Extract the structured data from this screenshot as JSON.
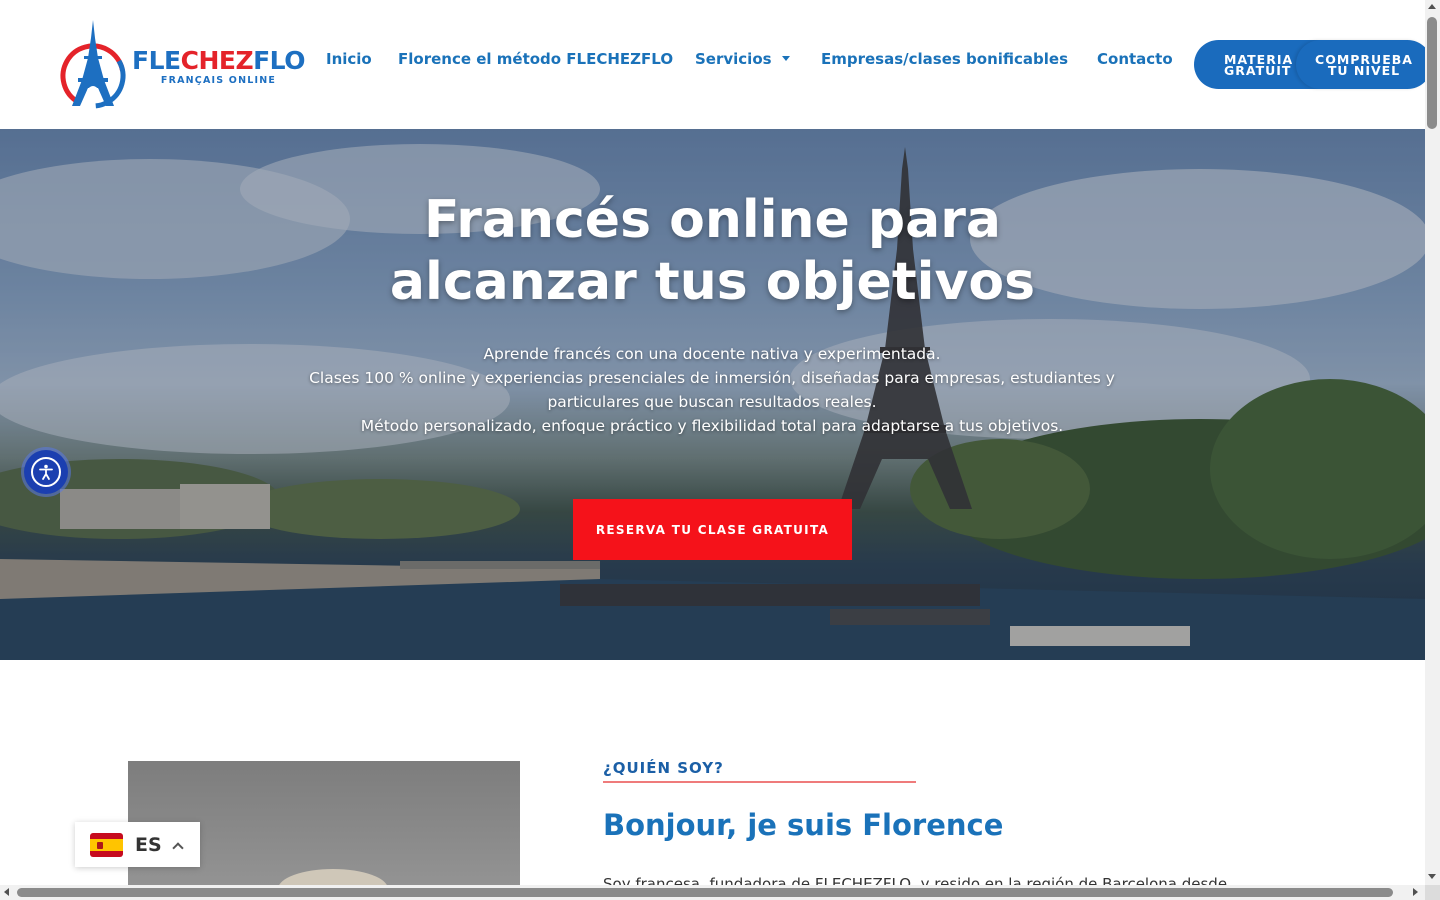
{
  "logo": {
    "part1": "FLE",
    "part2": "CHEZ",
    "part3": "FLO",
    "tagline": "FRANÇAIS ONLINE"
  },
  "nav": {
    "items": [
      {
        "label": "Inicio"
      },
      {
        "label": "Florence el método FLECHEZFLO"
      },
      {
        "label": "Servicios"
      },
      {
        "label": "Empresas/clases bonificables"
      },
      {
        "label": "Contacto"
      }
    ],
    "button_materials_line1": "MATERIAL",
    "button_materials_line2": "GRATUITO",
    "button_level_line1": "COMPRUEBA",
    "button_level_line2": "TU NIVEL"
  },
  "hero": {
    "title_line1": "Francés online para",
    "title_line2": "alcanzar tus objetivos",
    "sub_line1": "Aprende francés con una docente nativa y experimentada.",
    "sub_line2": "Clases 100 % online y experiencias presenciales de inmersión, diseñadas para empresas, estudiantes y",
    "sub_line3": "particulares que buscan resultados reales.",
    "sub_line4": "Método personalizado, enfoque práctico y flexibilidad total para adaptarse a tus objetivos.",
    "cta": "RESERVA TU CLASE GRATUITA"
  },
  "about": {
    "eyebrow": "¿QUIÉN SOY?",
    "title": "Bonjour, je suis Florence",
    "text": "Soy francesa, fundadora de FLECHEZFLO, y resido en la región de Barcelona desde"
  },
  "language": {
    "code": "ES",
    "flag": "spain-flag-icon"
  },
  "colors": {
    "brand_blue": "#1a72b9",
    "brand_red": "#f5121a",
    "button_blue": "#1a6bbd",
    "eyebrow_underline": "#ef7b7b"
  },
  "icons": {
    "accessibility": "accessibility-icon",
    "dropdown": "caret-down-icon",
    "lang_toggle": "chevron-up-icon"
  }
}
